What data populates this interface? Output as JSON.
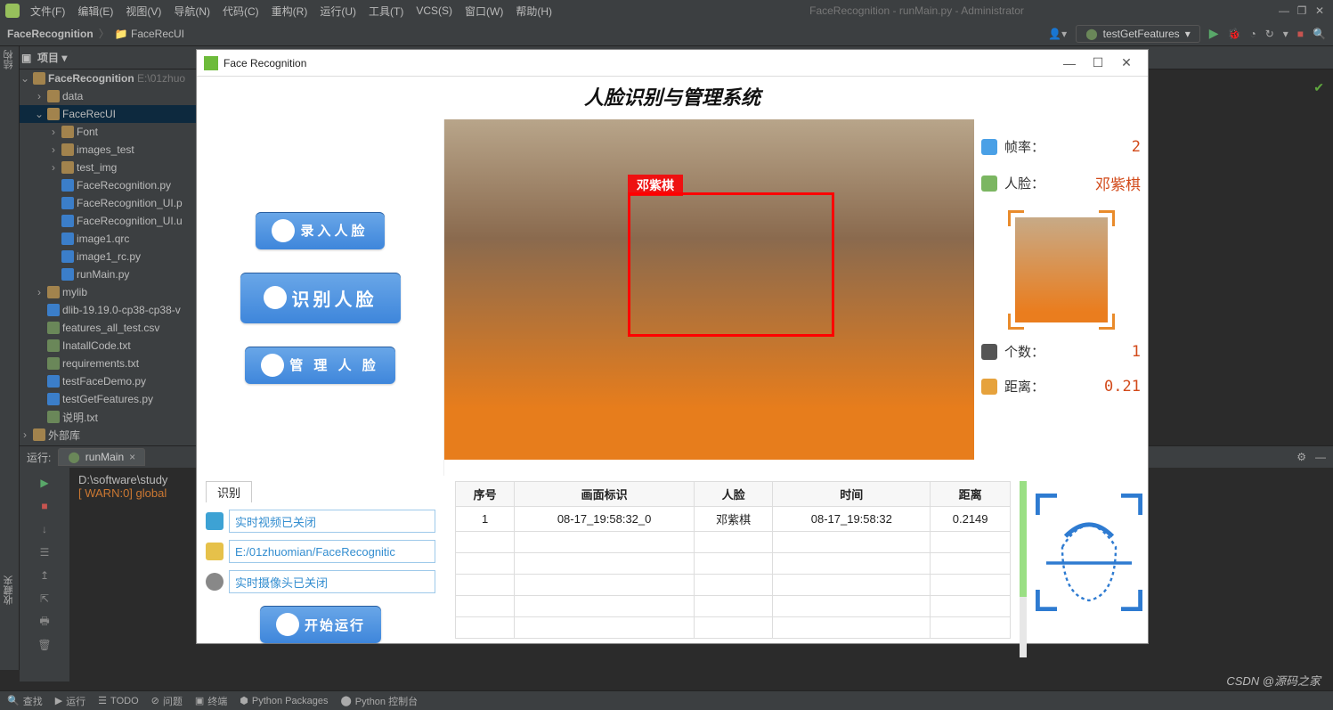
{
  "ide": {
    "menus": [
      "文件(F)",
      "编辑(E)",
      "视图(V)",
      "导航(N)",
      "代码(C)",
      "重构(R)",
      "运行(U)",
      "工具(T)",
      "VCS(S)",
      "窗口(W)",
      "帮助(H)"
    ],
    "app_title": "FaceRecognition - runMain.py - Administrator",
    "breadcrumbs": [
      "FaceRecognition",
      "FaceRecUI"
    ],
    "run_config": "testGetFeatures",
    "project_label": "项目",
    "run_label_left": "运行:",
    "left_tabs": {
      "structure": "结构",
      "favorites": "收藏夹"
    }
  },
  "tree": {
    "root": {
      "name": "FaceRecognition",
      "path": "E:\\01zhuo"
    },
    "nodes": [
      {
        "i": 1,
        "t": "fld",
        "n": "data"
      },
      {
        "i": 1,
        "t": "fld",
        "n": "FaceRecUI",
        "sel": true,
        "open": true
      },
      {
        "i": 2,
        "t": "fld",
        "n": "Font"
      },
      {
        "i": 2,
        "t": "fld",
        "n": "images_test"
      },
      {
        "i": 2,
        "t": "fld",
        "n": "test_img"
      },
      {
        "i": 2,
        "t": "py",
        "n": "FaceRecognition.py"
      },
      {
        "i": 2,
        "t": "py",
        "n": "FaceRecognition_UI.p"
      },
      {
        "i": 2,
        "t": "py",
        "n": "FaceRecognition_UI.u"
      },
      {
        "i": 2,
        "t": "py",
        "n": "image1.qrc"
      },
      {
        "i": 2,
        "t": "py",
        "n": "image1_rc.py"
      },
      {
        "i": 2,
        "t": "py",
        "n": "runMain.py"
      },
      {
        "i": 1,
        "t": "fld",
        "n": "mylib"
      },
      {
        "i": 1,
        "t": "py",
        "n": "dlib-19.19.0-cp38-cp38-v"
      },
      {
        "i": 1,
        "t": "txt",
        "n": "features_all_test.csv"
      },
      {
        "i": 1,
        "t": "txt",
        "n": "InatallCode.txt"
      },
      {
        "i": 1,
        "t": "txt",
        "n": "requirements.txt"
      },
      {
        "i": 1,
        "t": "py",
        "n": "testFaceDemo.py"
      },
      {
        "i": 1,
        "t": "py",
        "n": "testGetFeatures.py"
      },
      {
        "i": 1,
        "t": "txt",
        "n": "说明.txt"
      },
      {
        "i": 0,
        "t": "fld",
        "n": "外部库"
      }
    ]
  },
  "run_tab": {
    "name": "runMain"
  },
  "console": {
    "line1": "D:\\software\\study",
    "line2": "[ WARN:0] global"
  },
  "statusbar": [
    "查找",
    "运行",
    "TODO",
    "问题",
    "终端",
    "Python Packages",
    "Python 控制台"
  ],
  "watermark": "CSDN @源码之家",
  "dlg": {
    "title": "Face Recognition",
    "heading": "人脸识别与管理系统",
    "buttons": {
      "enroll": "录入人脸",
      "recognize": "识别人脸",
      "manage": "管 理 人 脸",
      "run": "开始运行"
    },
    "face_label": "邓紫棋",
    "stats": {
      "fps_label": "帧率：",
      "fps_val": "2",
      "face_label": "人脸：",
      "face_val": "邓紫棋",
      "count_label": "个数：",
      "count_val": "1",
      "dist_label": "距离：",
      "dist_val": "0.21"
    },
    "tab": "识别",
    "inputs": {
      "video": "实时视频已关闭",
      "path": "E:/01zhuomian/FaceRecognitic",
      "camera": "实时摄像头已关闭"
    },
    "table": {
      "headers": [
        "序号",
        "画面标识",
        "人脸",
        "时间",
        "距离"
      ],
      "rows": [
        [
          "1",
          "08-17_19:58:32_0",
          "邓紫棋",
          "08-17_19:58:32",
          "0.2149"
        ]
      ]
    }
  }
}
